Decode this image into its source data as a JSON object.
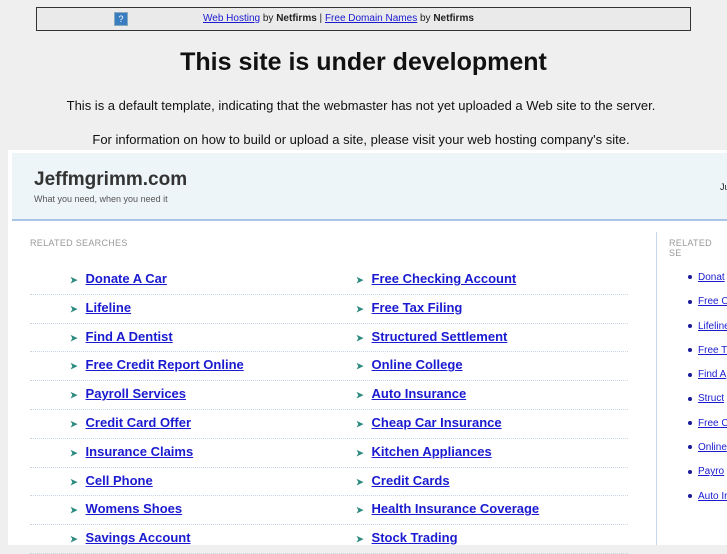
{
  "topbar": {
    "link1": "Web Hosting",
    "by1": " by ",
    "brand1": "Netfirms",
    "sep": " | ",
    "link2": "Free Domain Names",
    "by2": " by ",
    "brand2": "Netfirms",
    "help": "?"
  },
  "title": "This site is under development",
  "para1": "This is a default template, indicating that the webmaster has not yet uploaded a Web site to the server.",
  "para2": "For information on how to build or upload a site, please visit your web hosting company's site.",
  "site": {
    "name": "Jeffmgrimm.com",
    "tagline": "What you need, when you need it",
    "right_text": "Ju"
  },
  "left": {
    "heading": "RELATED SEARCHES",
    "rows": [
      [
        "Donate A Car",
        "Free Checking Account"
      ],
      [
        "Lifeline",
        "Free Tax Filing"
      ],
      [
        "Find A Dentist",
        "Structured Settlement"
      ],
      [
        "Free Credit Report Online",
        "Online College"
      ],
      [
        "Payroll Services",
        "Auto Insurance"
      ],
      [
        "Credit Card Offer",
        "Cheap Car Insurance"
      ],
      [
        "Insurance Claims",
        "Kitchen Appliances"
      ],
      [
        "Cell Phone",
        "Credit Cards"
      ],
      [
        "Womens Shoes",
        "Health Insurance Coverage"
      ],
      [
        "Savings Account",
        "Stock Trading"
      ]
    ]
  },
  "right": {
    "heading": "RELATED SE",
    "items": [
      "Donat",
      "Free C",
      "Lifeline",
      "Free T",
      "Find A",
      "Struct",
      "Free C",
      "Online",
      "Payro",
      "Auto Ir"
    ]
  }
}
